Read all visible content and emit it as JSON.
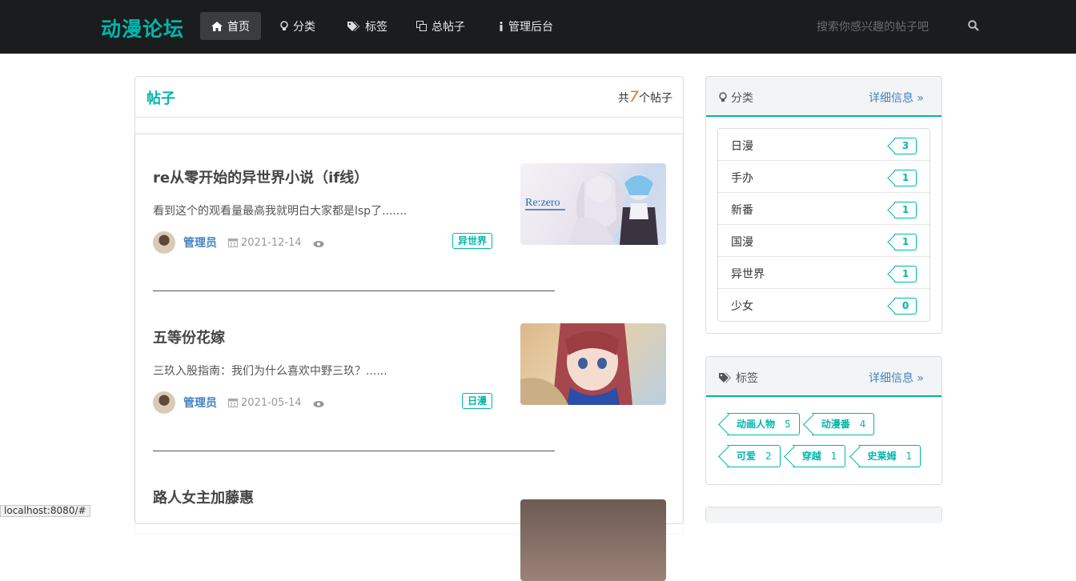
{
  "navbar": {
    "brand": "动漫论坛",
    "items": [
      {
        "label": "首页",
        "icon": "home-icon"
      },
      {
        "label": "分类",
        "icon": "lightbulb-icon"
      },
      {
        "label": "标签",
        "icon": "tags-icon"
      },
      {
        "label": "总帖子",
        "icon": "clone-icon"
      },
      {
        "label": "管理后台",
        "icon": "info-icon"
      }
    ],
    "search_placeholder": "搜索你感兴趣的帖子吧"
  },
  "posts": {
    "title": "帖子",
    "count_prefix": "共",
    "count": "7",
    "count_suffix": "个帖子",
    "items": [
      {
        "title": "re从零开始的异世界小说（if线）",
        "desc": "看到这个的观看量最高我就明白大家都是lsp了.......",
        "author": "管理员",
        "date": "2021-12-14",
        "tag": "异世界",
        "thumb_text": "Re:zero"
      },
      {
        "title": "五等份花嫁",
        "desc": "三玖入股指南：我们为什么喜欢中野三玖？......",
        "author": "管理员",
        "date": "2021-05-14",
        "tag": "日漫"
      },
      {
        "title": "路人女主加藤惠"
      }
    ]
  },
  "categories": {
    "title": "分类",
    "more": "详细信息 »",
    "items": [
      {
        "name": "日漫",
        "count": "3"
      },
      {
        "name": "手办",
        "count": "1"
      },
      {
        "name": "新番",
        "count": "1"
      },
      {
        "name": "国漫",
        "count": "1"
      },
      {
        "name": "异世界",
        "count": "1"
      },
      {
        "name": "少女",
        "count": "0"
      }
    ]
  },
  "tags": {
    "title": "标签",
    "more": "详细信息 »",
    "items": [
      {
        "name": "动画人物",
        "count": "5"
      },
      {
        "name": "动漫番",
        "count": "4"
      },
      {
        "name": "可爱",
        "count": "2"
      },
      {
        "name": "穿越",
        "count": "1"
      },
      {
        "name": "史莱姆",
        "count": "1"
      }
    ]
  },
  "statusbar": "localhost:8080/#",
  "colors": {
    "accent": "#00b5ad",
    "link": "#4183c4",
    "navbar": "#1b1c1d",
    "count": "#f2711c"
  }
}
